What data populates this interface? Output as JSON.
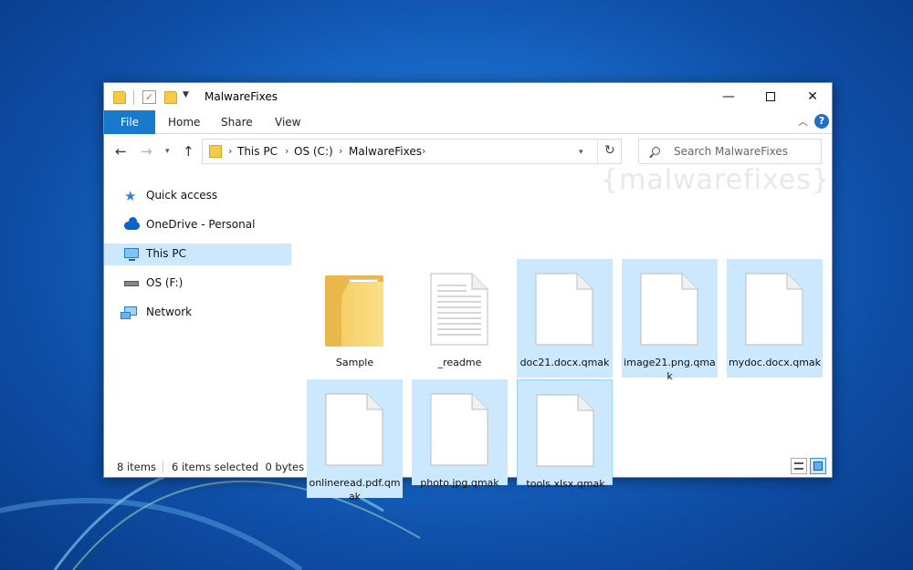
{
  "window": {
    "title": "MalwareFixes",
    "minimize": "—",
    "close": "✕"
  },
  "ribbon": {
    "tabs": [
      "File",
      "Home",
      "Share",
      "View"
    ]
  },
  "navigation": {
    "breadcrumb": [
      "This PC",
      "OS (C:)",
      "MalwareFixes"
    ],
    "search_placeholder": "Search MalwareFixes"
  },
  "sidebar": {
    "items": [
      {
        "label": "Quick access",
        "icon": "star-icon"
      },
      {
        "label": "OneDrive - Personal",
        "icon": "cloud-icon"
      },
      {
        "label": "This PC",
        "icon": "computer-icon",
        "active": true
      },
      {
        "label": "OS (F:)",
        "icon": "drive-icon"
      },
      {
        "label": "Network",
        "icon": "network-icon"
      }
    ]
  },
  "files": [
    {
      "name": "Sample",
      "type": "folder",
      "selected": false
    },
    {
      "name": "_readme",
      "type": "text",
      "selected": false
    },
    {
      "name": "doc21.docx.qmak",
      "type": "file",
      "selected": true
    },
    {
      "name": "image21.png.qmak",
      "type": "file",
      "selected": true
    },
    {
      "name": "mydoc.docx.qmak",
      "type": "file",
      "selected": true
    },
    {
      "name": "onlineread.pdf.qmak",
      "type": "file",
      "selected": true
    },
    {
      "name": "photo.jpg.qmak",
      "type": "file",
      "selected": true
    },
    {
      "name": "tools.xlsx.qmak",
      "type": "file",
      "selected": true
    }
  ],
  "status": {
    "item_count": "8 items",
    "selection": "6 items selected  0 bytes"
  },
  "watermark": "{malwarefixes}",
  "colors": {
    "accent": "#1979ca",
    "selection": "#cce8ff"
  }
}
